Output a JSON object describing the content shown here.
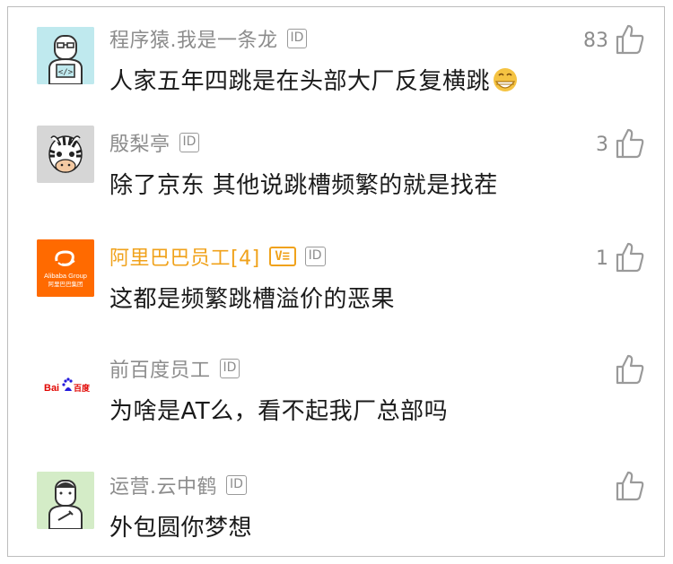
{
  "comments": [
    {
      "username": "程序猿.我是一条龙",
      "id_badge": "ID",
      "likes": "83",
      "text": "人家五年四跳是在头部大厂反复横跳",
      "emoji": "grinning-face-emoji",
      "avatar": "programmer-avatar"
    },
    {
      "username": "殷梨亭",
      "id_badge": "ID",
      "likes": "3",
      "text": "除了京东 其他说跳槽频繁的就是找茬",
      "avatar": "zebra-avatar"
    },
    {
      "username": "阿里巴巴员工[4]",
      "vip_badge": "V≡",
      "id_badge": "ID",
      "likes": "1",
      "text": "这都是频繁跳槽溢价的恶果",
      "avatar": "alibaba-logo-avatar",
      "avatar_text_1": "Alibaba Group",
      "avatar_text_2": "阿里巴巴集团",
      "username_color": "#f0a21b"
    },
    {
      "username": "前百度员工",
      "id_badge": "ID",
      "likes": "",
      "text": "为啥是AT么，看不起我厂总部吗",
      "avatar": "baidu-logo-avatar",
      "avatar_text_1": "Bai",
      "avatar_text_2": "百度"
    },
    {
      "username": "运营.云中鹤",
      "id_badge": "ID",
      "likes": "",
      "text": "外包圆你梦想",
      "avatar": "operator-avatar"
    }
  ],
  "colors": {
    "username": "#8c8c8c",
    "vip": "#f0a21b",
    "text": "#1a1a1a",
    "alibaba": "#ff6a00",
    "baidu_blue": "#2319dc",
    "baidu_red": "#e10602"
  }
}
